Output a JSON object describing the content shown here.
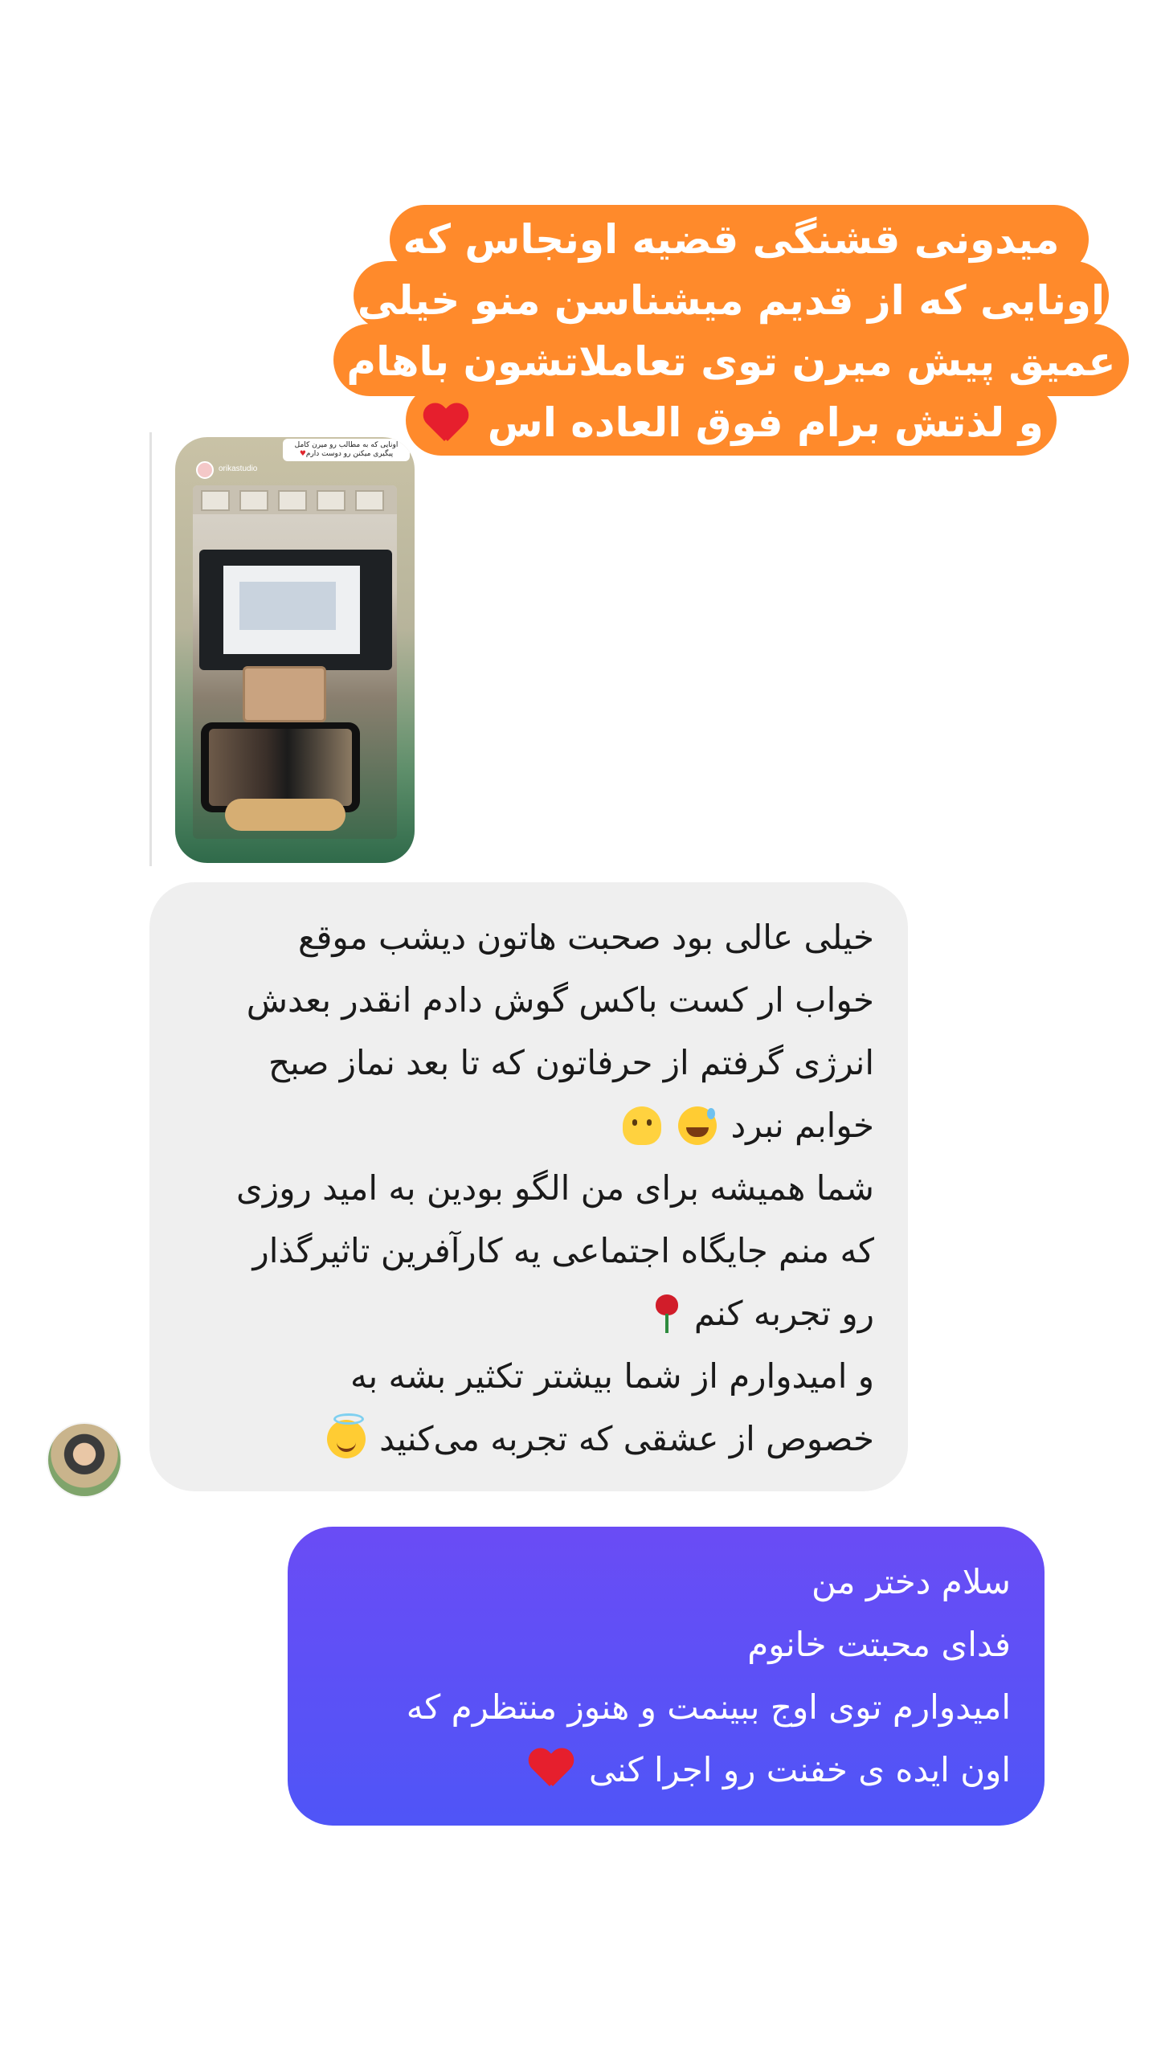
{
  "sticker_quote": {
    "lines": [
      "میدونی قشنگی قضیه اونجاس که",
      "اونایی که از قدیم میشناسن منو خیلی",
      "عمیق پیش میرن توی تعاملاتشون باهام",
      "و لذتش برام فوق العاده اس"
    ],
    "trailing_emoji": "red-heart",
    "color": "#ff8a2b"
  },
  "shared_story": {
    "username": "orikastudio",
    "caption": "اونایی که به مطالب رو میرن کامل پیگیری میکنن رو دوست دارم",
    "caption_emoji": "red-heart"
  },
  "received_message": {
    "lines": [
      "خیلی عالی بود صحبت هاتون دیشب موقع",
      "خواب ار کست باکس گوش دادم انقدر بعدش",
      "انرژی گرفتم از حرفاتون که تا بعد نماز صبح",
      "خوابم نبرد",
      "شما همیشه برای من الگو بودین به امید روزی",
      "که منم جایگاه اجتماعی یه کارآفرین تاثیرگذار",
      "رو تجربه کنم",
      "و امیدوارم از شما بیشتر تکثیر بشه به",
      "خصوص از عشقی که تجربه می‌کنید"
    ],
    "emojis": [
      "grinning-sweat",
      "melting-face",
      "rose",
      "smiling-halo"
    ],
    "bubble_color": "#efefef"
  },
  "sent_message": {
    "lines": [
      "سلام دختر من",
      "فدای محبتت خانوم",
      "امیدوارم توی اوج ببینمت و هنوز منتظرم که",
      "اون ایده ی خفنت رو اجرا کنی"
    ],
    "trailing_emoji": "red-heart",
    "bubble_color": "#5a50f6"
  }
}
